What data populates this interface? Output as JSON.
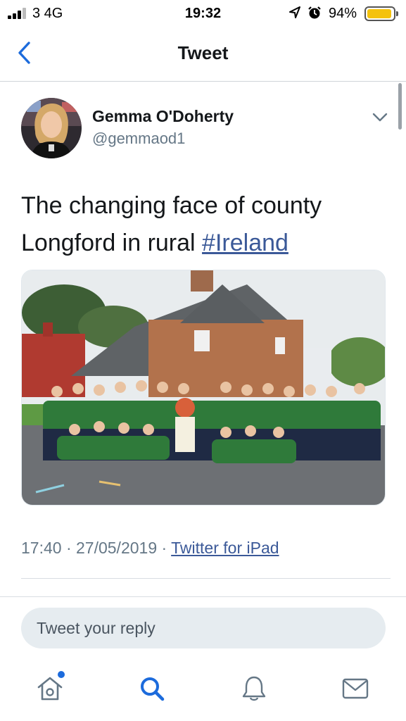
{
  "status_bar": {
    "carrier": "3  4G",
    "time": "19:32",
    "battery_percent": "94%",
    "battery_level": 0.94
  },
  "nav": {
    "title": "Tweet"
  },
  "tweet": {
    "author_name": "Gemma O'Doherty",
    "author_handle": "@gemmaod1",
    "text_plain": "The changing face of county Longford in rural ",
    "hashtag": "#Ireland",
    "timestamp": "17:40 · 27/05/2019 · ",
    "source": "Twitter for iPad"
  },
  "reply": {
    "placeholder": "Tweet your reply"
  },
  "tabs": [
    {
      "icon": "home-icon",
      "has_notification": true
    },
    {
      "icon": "search-icon",
      "active": true
    },
    {
      "icon": "bell-icon"
    },
    {
      "icon": "mail-icon"
    }
  ],
  "colors": {
    "link": "#3b5998",
    "tab_active": "#1c6bdc",
    "tab_inactive": "#657786",
    "back_arrow": "#1c6bdc",
    "battery": "#f4c20d"
  }
}
